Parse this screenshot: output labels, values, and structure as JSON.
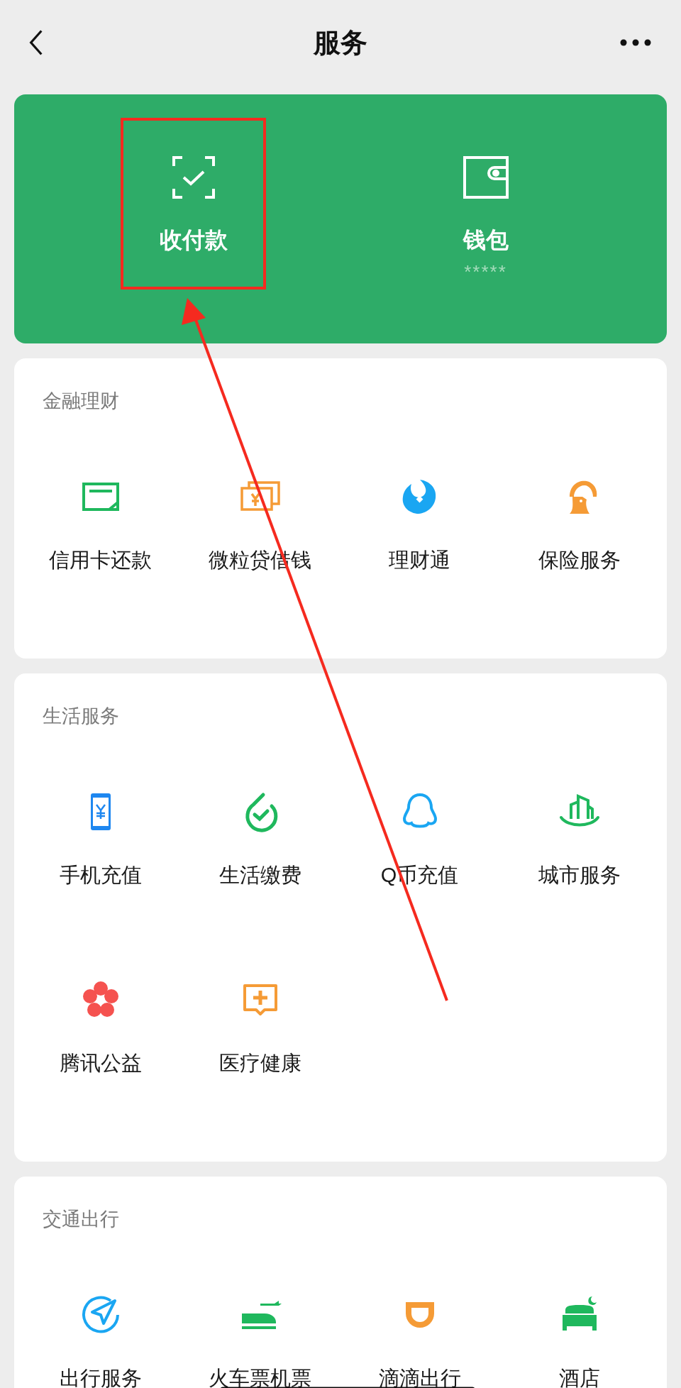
{
  "header": {
    "title": "服务"
  },
  "wallet_card": {
    "items": [
      {
        "label": "收付款",
        "highlighted": true
      },
      {
        "label": "钱包",
        "sub": "*****",
        "highlighted": false
      }
    ]
  },
  "sections": [
    {
      "title": "金融理财",
      "scribbled": false,
      "items": [
        {
          "label": "信用卡还款"
        },
        {
          "label": "微粒贷借钱"
        },
        {
          "label": "理财通"
        },
        {
          "label": "保险服务"
        }
      ]
    },
    {
      "title": "生活服务",
      "scribbled": false,
      "items": [
        {
          "label": "手机充值"
        },
        {
          "label": "生活缴费"
        },
        {
          "label": "Q币充值"
        },
        {
          "label": "城市服务"
        },
        {
          "label": "腾讯公益"
        },
        {
          "label": "医疗健康"
        }
      ]
    },
    {
      "title": "交通出行",
      "scribbled": true,
      "items": [
        {
          "label": "出行服务"
        },
        {
          "label": "火车票机票"
        },
        {
          "label": "滴滴出行"
        },
        {
          "label": "酒店"
        }
      ]
    }
  ]
}
